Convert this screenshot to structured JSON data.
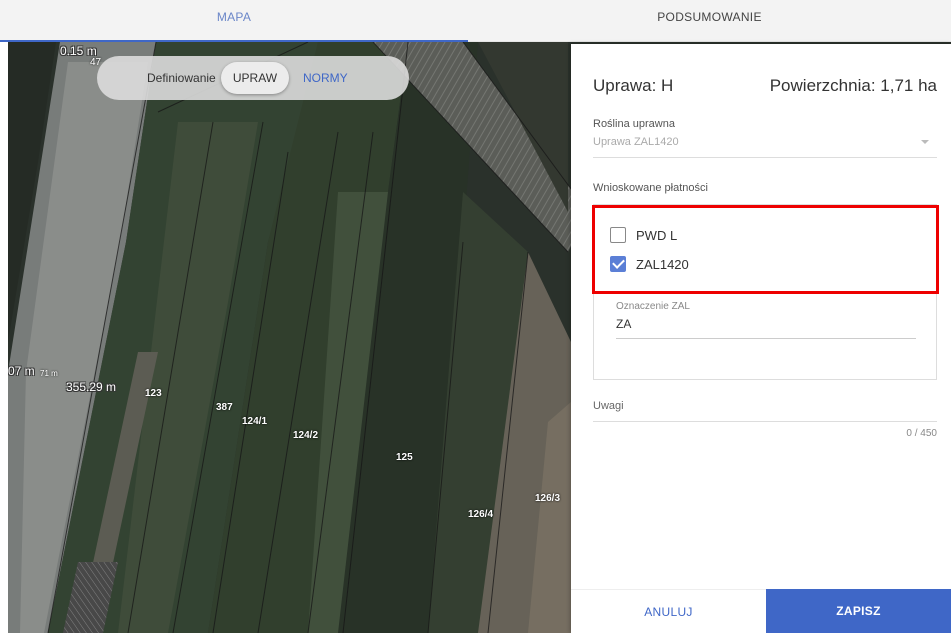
{
  "tabs": {
    "map": "MAPA",
    "summary": "PODSUMOWANIE"
  },
  "toggle": {
    "label": "Definiowanie",
    "crops": "UPRAW",
    "norms": "NORMY"
  },
  "map": {
    "distances": [
      "0.15 m",
      "07 m",
      "355.29 m"
    ],
    "small_labels": [
      "47",
      "71 m"
    ],
    "parcels": [
      "123",
      "387",
      "124/1",
      "124/2",
      "125",
      "126/3",
      "126/4"
    ]
  },
  "panel": {
    "title": "Uprawa: H",
    "area": "Powierzchnia: 1,71 ha",
    "crop_label": "Roślina uprawna",
    "crop_value": "Uprawa ZAL1420",
    "payments_label": "Wnioskowane płatności",
    "payments": [
      {
        "label": "PWD L",
        "checked": false
      },
      {
        "label": "ZAL1420",
        "checked": true
      }
    ],
    "designation_label": "Oznaczenie ZAL",
    "designation_value": "ZA",
    "remarks_label": "Uwagi",
    "counter": "0 / 450"
  },
  "buttons": {
    "cancel": "ANULUJ",
    "save": "ZAPISZ"
  },
  "colors": {
    "accent": "#3f67c7",
    "highlight": "#e00000",
    "checkbox": "#5b7fd6"
  }
}
